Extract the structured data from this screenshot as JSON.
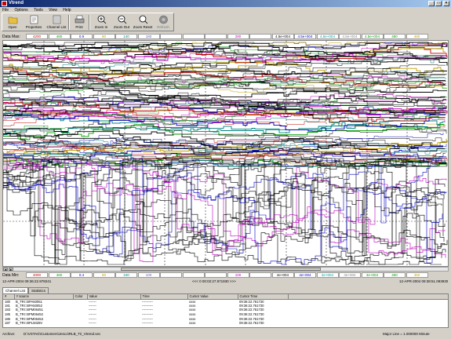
{
  "window": {
    "title": "Vtrend",
    "min": "_",
    "max": "□",
    "close": "×"
  },
  "menu": [
    "File",
    "Options",
    "Tools",
    "View",
    "Help"
  ],
  "toolbar": [
    {
      "label": "Open",
      "icon": "folder-icon"
    },
    {
      "label": "Properties",
      "icon": "properties-icon"
    },
    {
      "label": "Channel List",
      "icon": "channel-list-icon"
    },
    {
      "label": "Print",
      "icon": "printer-icon"
    },
    {
      "label": "Zoom In",
      "icon": "zoom-in-icon"
    },
    {
      "label": "Zoom Out",
      "icon": "zoom-out-icon"
    },
    {
      "label": "Zoom Reset",
      "icon": "zoom-reset-icon"
    },
    {
      "label": "Refresh",
      "icon": "refresh-icon"
    }
  ],
  "data_max": {
    "label": "Data Max:",
    "values": [
      {
        "v": "4200",
        "c": "#c00000"
      },
      {
        "v": "480",
        "c": "#00a000"
      },
      {
        "v": "0.9",
        "c": "#0000c0"
      },
      {
        "v": "80",
        "c": "#c0a000"
      },
      {
        "v": "140",
        "c": "#008080"
      },
      {
        "v": "180",
        "c": "#6060c0"
      },
      {
        "v": "",
        "c": "#000000"
      },
      {
        "v": "",
        "c": "#000000"
      },
      {
        "v": "",
        "c": "#000000"
      },
      {
        "v": "280",
        "c": "#c000c0"
      },
      {
        "v": "",
        "c": "#000000"
      },
      {
        "v": "4.5e+004",
        "c": "#000000"
      },
      {
        "v": "4.5e+004",
        "c": "#0000c0"
      },
      {
        "v": "4.5e+004",
        "c": "#00a0a0"
      },
      {
        "v": "4.5e+004",
        "c": "#808080"
      },
      {
        "v": "4.5e+004",
        "c": "#00a000"
      },
      {
        "v": "480",
        "c": "#00a000"
      },
      {
        "v": "480",
        "c": "#c0a000"
      }
    ]
  },
  "data_min": {
    "label": "Data Min:",
    "values": [
      {
        "v": "4000",
        "c": "#c00000"
      },
      {
        "v": "460",
        "c": "#00a000"
      },
      {
        "v": "0.4",
        "c": "#0000c0"
      },
      {
        "v": "50",
        "c": "#c0a000"
      },
      {
        "v": "100",
        "c": "#008080"
      },
      {
        "v": "100",
        "c": "#6060c0"
      },
      {
        "v": "",
        "c": "#000000"
      },
      {
        "v": "",
        "c": "#000000"
      },
      {
        "v": "",
        "c": "#000000"
      },
      {
        "v": "100",
        "c": "#c000c0"
      },
      {
        "v": "",
        "c": "#000000"
      },
      {
        "v": "4e+004",
        "c": "#000000"
      },
      {
        "v": "4e+004",
        "c": "#0000c0"
      },
      {
        "v": "4e+004",
        "c": "#00a0a0"
      },
      {
        "v": "4e+004",
        "c": "#808080"
      },
      {
        "v": "4e+004",
        "c": "#00a000"
      },
      {
        "v": "460",
        "c": "#00a000"
      },
      {
        "v": "460",
        "c": "#c0a000"
      }
    ]
  },
  "scroll": {
    "left_arrow": "◄",
    "right_arrow": "►"
  },
  "timeline": {
    "start": "12-APR-2004 09:36:22.978241",
    "center": "<<< 0 00:02:27.971930 >>>",
    "end": "12-APR-2004 09:38:51.093930"
  },
  "tabs": [
    "Channel List",
    "Statistics"
  ],
  "grid": {
    "headers": [
      "#",
      "Y source",
      "Color",
      "Value",
      "Time",
      "Cursor Value",
      "Cursor Time"
    ],
    "rows": [
      [
        "180",
        "B_TRI::BPA50051",
        "",
        "-------",
        "----------",
        "xxxx",
        "09:36:22.761730"
      ],
      [
        "181",
        "B_TRI::BPA50052",
        "",
        "-------",
        "----------",
        "xxxx",
        "09:36:22.761730"
      ],
      [
        "183",
        "B_TRI::BPM06451",
        "",
        "-------",
        "----------",
        "xxxx",
        "09:36:22.761730"
      ],
      [
        "185",
        "B_TRI::BPM06452",
        "",
        "-------",
        "----------",
        "xxxx",
        "09:36:22.761730"
      ],
      [
        "186",
        "B_TRI::BPM06453",
        "",
        "-------",
        "----------",
        "xxxx",
        "09:36:22.761730"
      ],
      [
        "187",
        "B_TRI::BPL5028V",
        "",
        "-------",
        "----------",
        "xxxx",
        "09:36:22.761730"
      ]
    ]
  },
  "status": {
    "archive_label": "Archive:",
    "archive_path": "D:\\VSTAG\\Customers\\Jesco\\RLB_Tri_Vtrend.vec",
    "major_line": "Major Line = 1.000000 Minute"
  }
}
